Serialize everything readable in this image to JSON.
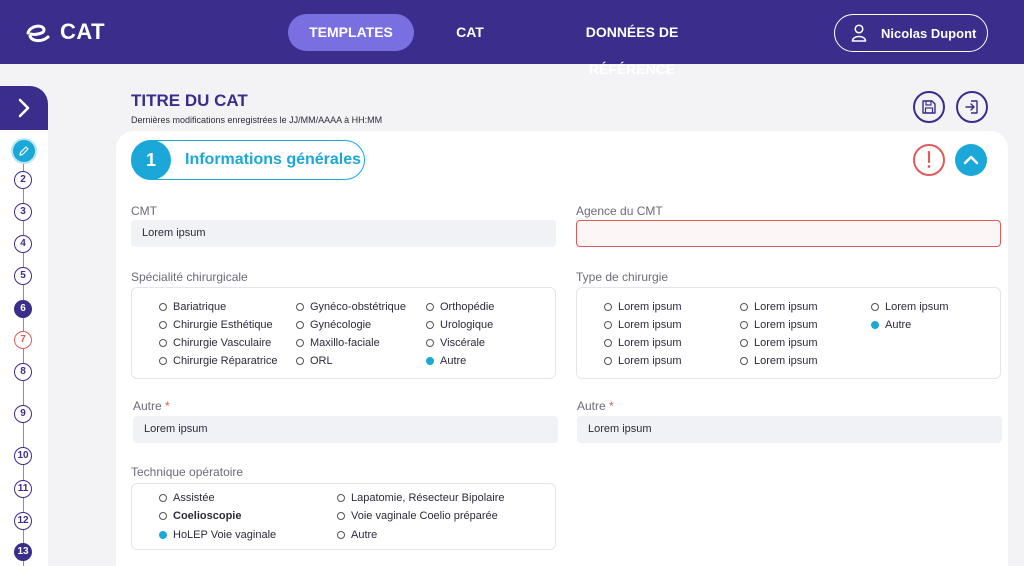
{
  "header": {
    "logo_text": "CAT",
    "nav": [
      {
        "label": "TEMPLATES",
        "active": true
      },
      {
        "label": "CAT",
        "active": false
      },
      {
        "label": "DONNÉES DE RÉFÉRENCE",
        "active": false
      }
    ],
    "user_name": "Nicolas Dupont"
  },
  "sidebar": {
    "steps": [
      "2",
      "3",
      "4",
      "5",
      "6",
      "7",
      "8",
      "9",
      "10",
      "11",
      "12",
      "13"
    ]
  },
  "page": {
    "title": "TITRE DU CAT",
    "subtitle": "Dernières modifications enregistrées le JJ/MM/AAAA à HH:MM"
  },
  "section": {
    "number": "1",
    "title": "Informations générales"
  },
  "form": {
    "cmt": {
      "label": "CMT",
      "value": "Lorem ipsum"
    },
    "agence": {
      "label": "Agence du CMT",
      "value": ""
    },
    "specialite": {
      "label": "Spécialité chirurgicale",
      "options": [
        "Bariatrique",
        "Chirurgie Esthétique",
        "Chirurgie Vasculaire",
        "Chirurgie Réparatrice",
        "Gynéco-obstétrique",
        "Gynécologie",
        "Maxillo-faciale",
        "ORL",
        "Orthopédie",
        "Urologique",
        "Viscérale",
        "Autre"
      ],
      "selected": "Autre"
    },
    "type": {
      "label": "Type de chirurgie",
      "options": [
        "Lorem ipsum",
        "Lorem ipsum",
        "Lorem ipsum",
        "Lorem ipsum",
        "Lorem ipsum",
        "Lorem ipsum",
        "Lorem ipsum",
        "Lorem ipsum",
        "Lorem ipsum",
        "Autre"
      ],
      "selected": "Autre"
    },
    "autre_left": {
      "label": "Autre",
      "required_mark": "*",
      "value": "Lorem ipsum"
    },
    "autre_right": {
      "label": "Autre",
      "required_mark": "*",
      "value": "Lorem ipsum"
    },
    "technique": {
      "label": "Technique opératoire",
      "options": [
        "Assistée",
        "Coelioscopie",
        "HoLEP Voie vaginale",
        "Lapatomie, Résecteur Bipolaire",
        "Voie vaginale Coelio préparée",
        "Autre"
      ],
      "selected": "HoLEP Voie vaginale"
    }
  },
  "colors": {
    "primary": "#3a2d8c",
    "accent": "#1ba8d8",
    "nav_active": "#7a6fe0",
    "error": "#e05a5a"
  },
  "icons": [
    "logo-e-icon",
    "user-icon",
    "chevron-right-icon",
    "pencil-icon",
    "save-icon",
    "exit-icon",
    "warning-icon",
    "chevron-up-icon"
  ]
}
